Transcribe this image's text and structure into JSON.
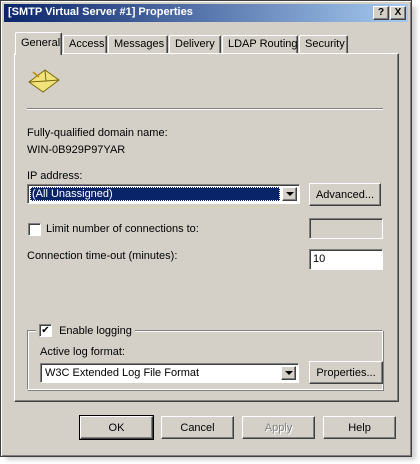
{
  "window": {
    "title": "[SMTP Virtual Server #1] Properties",
    "help_btn": "?",
    "close_btn": "X"
  },
  "tabs": [
    {
      "label": "General",
      "active": true
    },
    {
      "label": "Access",
      "active": false
    },
    {
      "label": "Messages",
      "active": false
    },
    {
      "label": "Delivery",
      "active": false
    },
    {
      "label": "LDAP Routing",
      "active": false
    },
    {
      "label": "Security",
      "active": false
    }
  ],
  "general": {
    "icon": "smtp-envelope-icon",
    "fqdn_label": "Fully-qualified domain name:",
    "fqdn_value": "WIN-0B929P97YAR",
    "ip_label": "IP address:",
    "ip_value": "(All Unassigned)",
    "advanced_btn": "Advanced...",
    "limit_label": "Limit number of connections to:",
    "limit_checked": false,
    "limit_value": "",
    "timeout_label": "Connection time-out (minutes):",
    "timeout_value": "10",
    "logging": {
      "label": "Enable logging",
      "checked": true,
      "check_mark": "✔",
      "format_label": "Active log format:",
      "format_value": "W3C Extended Log File Format",
      "properties_btn": "Properties..."
    }
  },
  "footer": {
    "ok": "OK",
    "cancel": "Cancel",
    "apply": "Apply",
    "help": "Help"
  },
  "colors": {
    "titlebar_start": "#0a246a",
    "titlebar_end": "#a6caf0",
    "face": "#d4d0c8",
    "selection": "#0a246a"
  }
}
